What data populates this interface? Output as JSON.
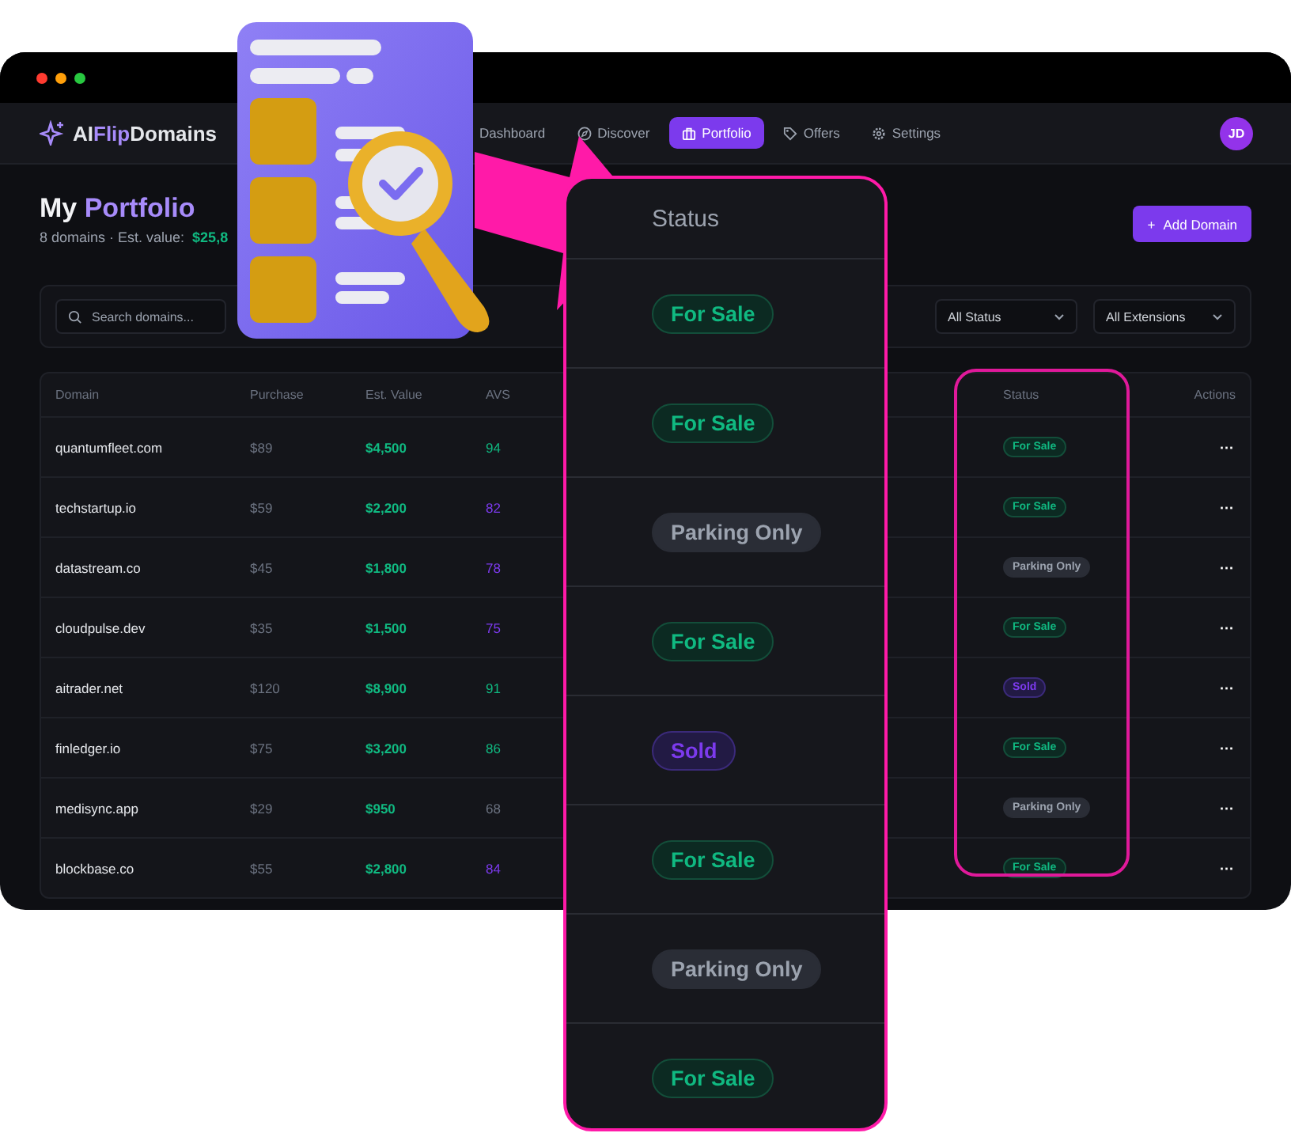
{
  "window": {
    "brand": {
      "prefix": "AI",
      "accent": "Flip",
      "suffix": "Domains"
    },
    "nav": [
      {
        "label": "Dashboard",
        "selected": false
      },
      {
        "label": "Discover",
        "selected": false
      },
      {
        "label": "Portfolio",
        "selected": true
      },
      {
        "label": "Offers",
        "selected": false
      },
      {
        "label": "Settings",
        "selected": false
      }
    ],
    "avatar": "JD"
  },
  "page": {
    "title": "My",
    "title_accent": "Portfolio",
    "summary": "8 domains · Est. value: ",
    "summary_value": "$25,8",
    "add_button": "Add Domain",
    "add_icon": "+"
  },
  "filters": {
    "search": {
      "placeholder": "Search domains..."
    },
    "selects": [
      "All Status",
      "All Extensions"
    ]
  },
  "table": {
    "columns": [
      "Domain",
      "Purchase",
      "Est. Value",
      "AVS",
      "Status",
      "Actions"
    ],
    "rows": [
      {
        "domain": "quantumfleet.com",
        "purchase": "$89",
        "value": "$4,500",
        "avs": {
          "text": "94",
          "color": "#10b981"
        },
        "status": {
          "text": "For Sale",
          "kind": "for-sale"
        }
      },
      {
        "domain": "techstartup.io",
        "purchase": "$59",
        "value": "$2,200",
        "avs": {
          "text": "82",
          "color": "#7c3aed"
        },
        "status": {
          "text": "For Sale",
          "kind": "for-sale"
        }
      },
      {
        "domain": "datastream.co",
        "purchase": "$45",
        "value": "$1,800",
        "avs": {
          "text": "78",
          "color": "#7c3aed"
        },
        "status": {
          "text": "Parking Only",
          "kind": "parking"
        }
      },
      {
        "domain": "cloudpulse.dev",
        "purchase": "$35",
        "value": "$1,500",
        "avs": {
          "text": "75",
          "color": "#7c3aed"
        },
        "status": {
          "text": "For Sale",
          "kind": "for-sale"
        }
      },
      {
        "domain": "aitrader.net",
        "purchase": "$120",
        "value": "$8,900",
        "avs": {
          "text": "91",
          "color": "#10b981"
        },
        "status": {
          "text": "Sold",
          "kind": "sold"
        }
      },
      {
        "domain": "finledger.io",
        "purchase": "$75",
        "value": "$3,200",
        "avs": {
          "text": "86",
          "color": "#10b981"
        },
        "status": {
          "text": "For Sale",
          "kind": "for-sale"
        }
      },
      {
        "domain": "medisync.app",
        "purchase": "$29",
        "value": "$950",
        "avs": {
          "text": "68",
          "color": "#6b7280"
        },
        "status": {
          "text": "Parking Only",
          "kind": "parking"
        }
      },
      {
        "domain": "blockbase.co",
        "purchase": "$55",
        "value": "$2,800",
        "avs": {
          "text": "84",
          "color": "#7c3aed"
        },
        "status": {
          "text": "For Sale",
          "kind": "for-sale"
        }
      }
    ],
    "action": "···"
  },
  "zoom_panel": {
    "title": "Status",
    "badges": [
      {
        "text": "For Sale",
        "kind": "for-sale"
      },
      {
        "text": "For Sale",
        "kind": "for-sale"
      },
      {
        "text": "Parking Only",
        "kind": "parking"
      },
      {
        "text": "For Sale",
        "kind": "for-sale"
      },
      {
        "text": "Sold",
        "kind": "sold"
      },
      {
        "text": "For Sale",
        "kind": "for-sale"
      },
      {
        "text": "Parking Only",
        "kind": "parking"
      },
      {
        "text": "For Sale",
        "kind": "for-sale"
      }
    ]
  }
}
